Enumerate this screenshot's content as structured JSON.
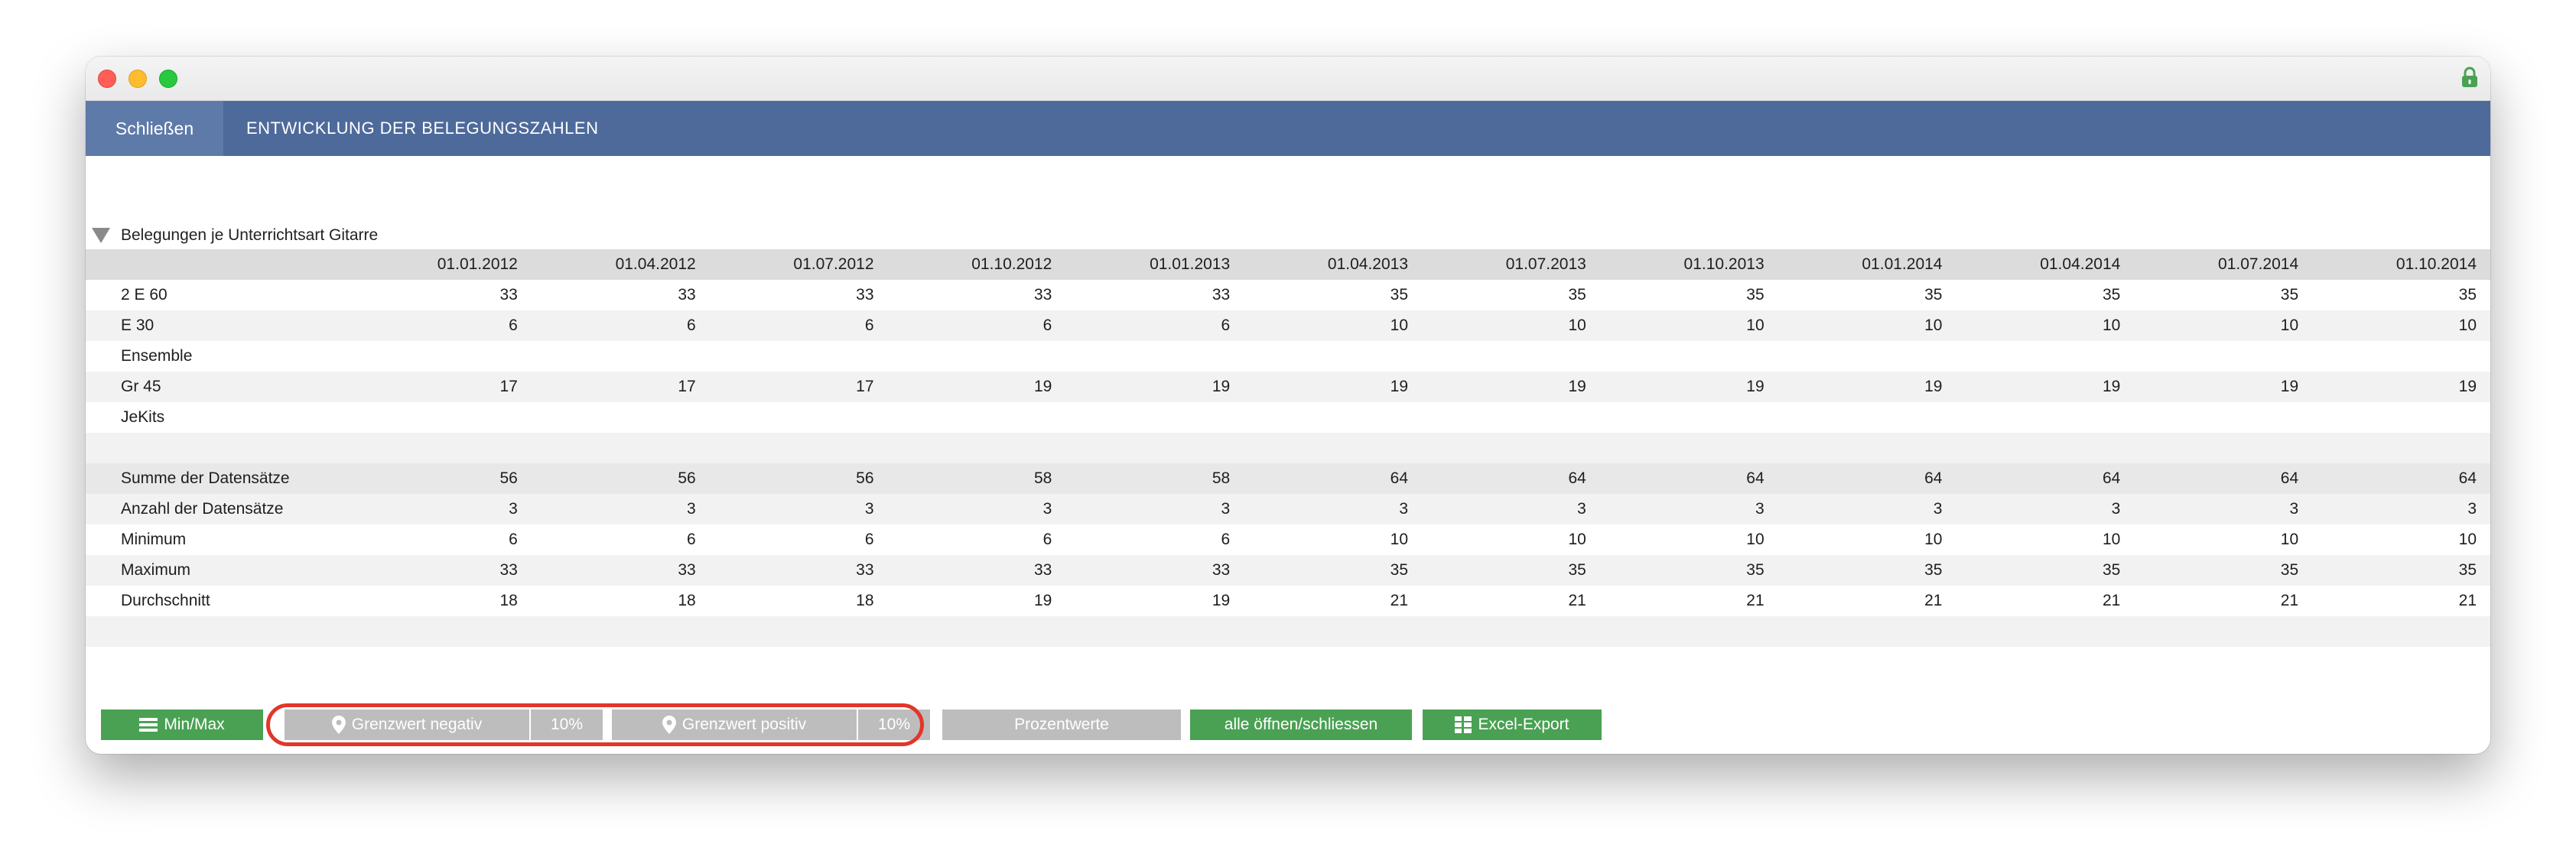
{
  "nav": {
    "close_label": "Schließen",
    "title": "ENTWICKLUNG DER BELEGUNGSZAHLEN"
  },
  "section": {
    "title": "Belegungen je Unterrichtsart Gitarre"
  },
  "table": {
    "columns": [
      "01.01.2012",
      "01.04.2012",
      "01.07.2012",
      "01.10.2012",
      "01.01.2013",
      "01.04.2013",
      "01.07.2013",
      "01.10.2013",
      "01.01.2014",
      "01.04.2014",
      "01.07.2014",
      "01.10.2014"
    ],
    "rows": [
      {
        "label": "2 E 60",
        "values": [
          "33",
          "33",
          "33",
          "33",
          "33",
          "35",
          "35",
          "35",
          "35",
          "35",
          "35",
          "35"
        ]
      },
      {
        "label": "E 30",
        "values": [
          "6",
          "6",
          "6",
          "6",
          "6",
          "10",
          "10",
          "10",
          "10",
          "10",
          "10",
          "10"
        ]
      },
      {
        "label": "Ensemble",
        "values": [
          "",
          "",
          "",
          "",
          "",
          "",
          "",
          "",
          "",
          "",
          "",
          ""
        ]
      },
      {
        "label": "Gr 45",
        "values": [
          "17",
          "17",
          "17",
          "19",
          "19",
          "19",
          "19",
          "19",
          "19",
          "19",
          "19",
          "19"
        ]
      },
      {
        "label": "JeKits",
        "values": [
          "",
          "",
          "",
          "",
          "",
          "",
          "",
          "",
          "",
          "",
          "",
          ""
        ]
      },
      {
        "label": "",
        "values": [
          "",
          "",
          "",
          "",
          "",
          "",
          "",
          "",
          "",
          "",
          "",
          ""
        ]
      },
      {
        "label": "Summe der Datensätze",
        "values": [
          "56",
          "56",
          "56",
          "58",
          "58",
          "64",
          "64",
          "64",
          "64",
          "64",
          "64",
          "64"
        ]
      },
      {
        "label": "Anzahl der Datensätze",
        "values": [
          "3",
          "3",
          "3",
          "3",
          "3",
          "3",
          "3",
          "3",
          "3",
          "3",
          "3",
          "3"
        ]
      },
      {
        "label": "Minimum",
        "values": [
          "6",
          "6",
          "6",
          "6",
          "6",
          "10",
          "10",
          "10",
          "10",
          "10",
          "10",
          "10"
        ]
      },
      {
        "label": "Maximum",
        "values": [
          "33",
          "33",
          "33",
          "33",
          "33",
          "35",
          "35",
          "35",
          "35",
          "35",
          "35",
          "35"
        ]
      },
      {
        "label": "Durchschnitt",
        "values": [
          "18",
          "18",
          "18",
          "19",
          "19",
          "21",
          "21",
          "21",
          "21",
          "21",
          "21",
          "21"
        ]
      },
      {
        "label": "",
        "values": [
          "",
          "",
          "",
          "",
          "",
          "",
          "",
          "",
          "",
          "",
          "",
          ""
        ]
      }
    ]
  },
  "toolbar": {
    "minmax_label": "Min/Max",
    "neg_label": "Grenzwert negativ",
    "neg_value": "10%",
    "pos_label": "Grenzwert positiv",
    "pos_value": "10%",
    "percent_label": "Prozentwerte",
    "toggle_label": "alle öffnen/schliessen",
    "export_label": "Excel-Export"
  },
  "colors": {
    "nav_bg": "#4d6a9b",
    "green": "#4aa153",
    "gray_button": "#bdbdbd",
    "highlight": "#e2362b"
  }
}
